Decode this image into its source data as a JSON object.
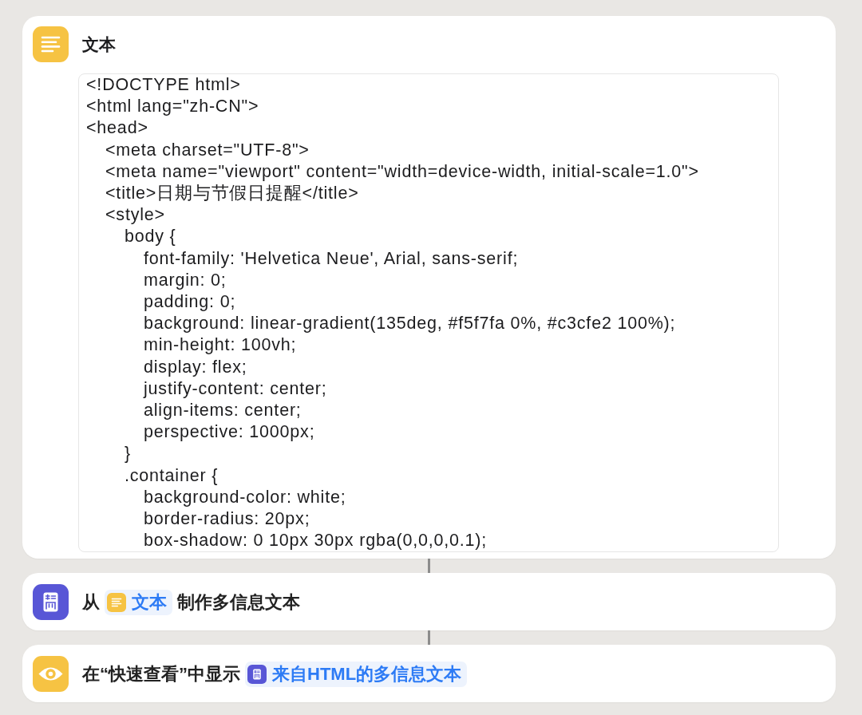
{
  "actions": [
    {
      "kind": "text",
      "title": "文本",
      "code": [
        {
          "line": "<!DOCTYPE html>"
        },
        {
          "line": "<html lang=\"zh-CN\">"
        },
        {
          "line": "<head>",
          "children": [
            {
              "line": "<meta charset=\"UTF-8\">"
            },
            {
              "line": "<meta name=\"viewport\" content=\"width=device-width, initial-scale=1.0\">"
            },
            {
              "line": "<title>日期与节假日提醒</title>"
            },
            {
              "line": "<style>",
              "children": [
                {
                  "line": "body {",
                  "children": [
                    {
                      "line": "font-family: 'Helvetica Neue', Arial, sans-serif;"
                    },
                    {
                      "line": "margin: 0;"
                    },
                    {
                      "line": "padding: 0;"
                    },
                    {
                      "line": "background: linear-gradient(135deg, #f5f7fa 0%, #c3cfe2 100%);"
                    },
                    {
                      "line": "min-height: 100vh;"
                    },
                    {
                      "line": "display: flex;"
                    },
                    {
                      "line": "justify-content: center;"
                    },
                    {
                      "line": "align-items: center;"
                    },
                    {
                      "line": "perspective: 1000px;"
                    }
                  ]
                },
                {
                  "line": "}"
                },
                {
                  "line": ".container {",
                  "children": [
                    {
                      "line": "background-color: white;"
                    },
                    {
                      "line": "border-radius: 20px;"
                    },
                    {
                      "line": "box-shadow: 0 10px 30px rgba(0,0,0,0.1);"
                    }
                  ]
                }
              ]
            }
          ]
        }
      ]
    },
    {
      "kind": "make_rich_text",
      "parts": [
        {
          "kind": "label",
          "text": "从"
        },
        {
          "kind": "text_variable",
          "text": "文本"
        },
        {
          "kind": "label",
          "text": "制作多信息文本"
        }
      ]
    },
    {
      "kind": "quick_look",
      "parts": [
        {
          "kind": "label",
          "text": "在“快速查看”中显示"
        },
        {
          "kind": "rich_text_variable",
          "text": "来自HTML的多信息文本"
        }
      ]
    }
  ]
}
